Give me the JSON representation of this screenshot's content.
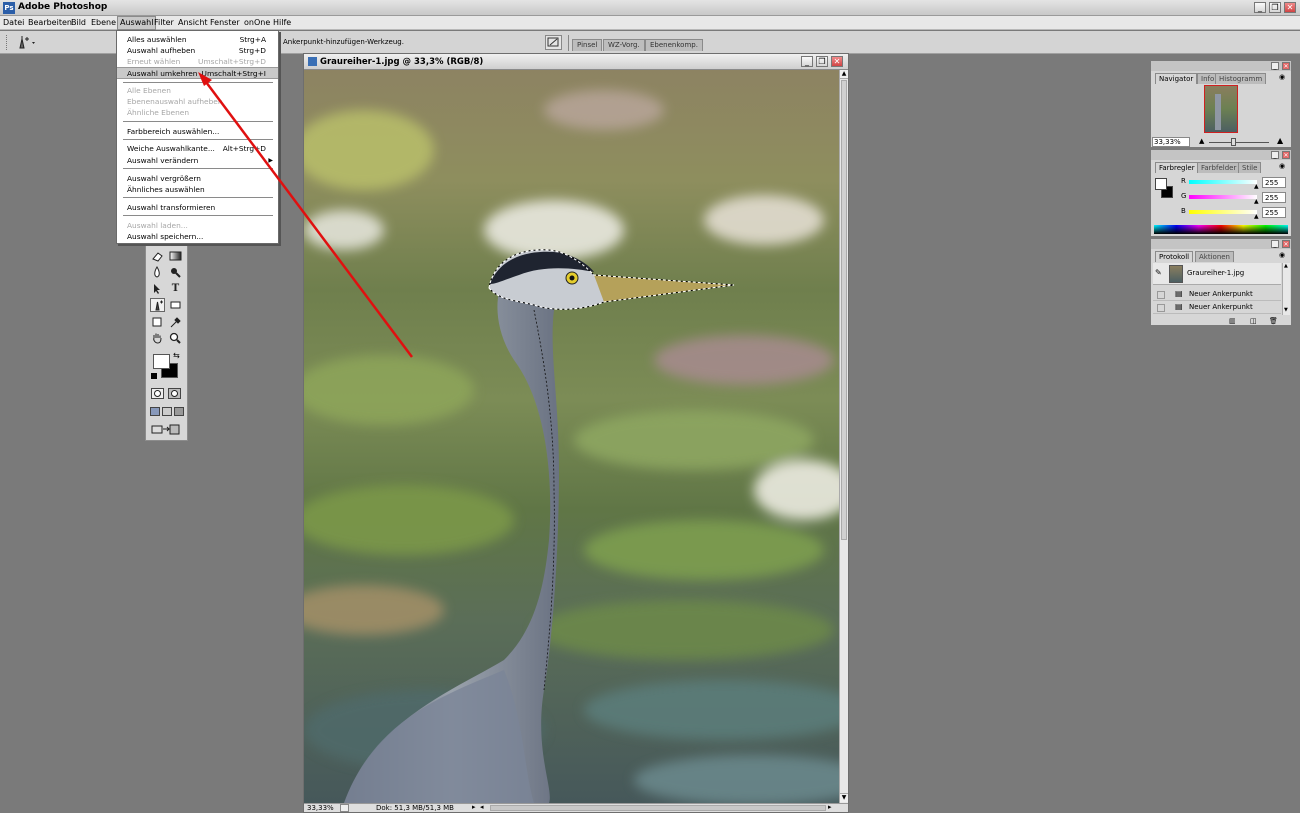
{
  "app": {
    "title": "Adobe Photoshop",
    "icon_name": "photoshop-icon",
    "window_buttons": [
      "_",
      "❐",
      "✕"
    ]
  },
  "menubar": [
    {
      "label": "Datei"
    },
    {
      "label": "Bearbeiten"
    },
    {
      "label": "Bild"
    },
    {
      "label": "Ebene"
    },
    {
      "label": "Auswahl",
      "active": true
    },
    {
      "label": "Filter"
    },
    {
      "label": "Ansicht"
    },
    {
      "label": "Fenster"
    },
    {
      "label": "onOne"
    },
    {
      "label": "Hilfe"
    }
  ],
  "options_bar": {
    "tool_icon": "add-anchor-point-pen-icon",
    "hint": "Ankerpunkt-hinzufügen-Werkzeug.",
    "palette_well_tabs": [
      "Pinsel",
      "WZ-Vorg.",
      "Ebenenkomp."
    ]
  },
  "auswahl_menu": {
    "items": [
      {
        "label": "Alles auswählen",
        "shortcut": "Strg+A",
        "enabled": true
      },
      {
        "label": "Auswahl aufheben",
        "shortcut": "Strg+D",
        "enabled": true
      },
      {
        "label": "Erneut wählen",
        "shortcut": "Umschalt+Strg+D",
        "enabled": false
      },
      {
        "label": "Auswahl umkehren",
        "shortcut": "Umschalt+Strg+I",
        "enabled": true,
        "highlighted": true
      },
      {
        "label": "Alle Ebenen",
        "shortcut": "",
        "enabled": false
      },
      {
        "label": "Ebenenauswahl aufheben",
        "shortcut": "",
        "enabled": false
      },
      {
        "label": "Ähnliche Ebenen",
        "shortcut": "",
        "enabled": false
      },
      {
        "label": "Farbbereich auswählen...",
        "shortcut": "",
        "enabled": true
      },
      {
        "label": "Weiche Auswahlkante...",
        "shortcut": "Alt+Strg+D",
        "enabled": true
      },
      {
        "label": "Auswahl verändern",
        "shortcut": "",
        "enabled": true,
        "submenu": true
      },
      {
        "label": "Auswahl vergrößern",
        "shortcut": "",
        "enabled": true
      },
      {
        "label": "Ähnliches auswählen",
        "shortcut": "",
        "enabled": true
      },
      {
        "label": "Auswahl transformieren",
        "shortcut": "",
        "enabled": true
      },
      {
        "label": "Auswahl laden...",
        "shortcut": "",
        "enabled": false
      },
      {
        "label": "Auswahl speichern...",
        "shortcut": "",
        "enabled": true
      }
    ]
  },
  "toolbox": {
    "tools": [
      "eraser-icon",
      "gradient-icon",
      "blur-icon",
      "dodge-icon",
      "path-selection-icon",
      "type-icon",
      "pen-icon",
      "shape-icon",
      "notes-icon",
      "eyedropper-icon",
      "hand-icon",
      "zoom-icon"
    ],
    "type_glyph": "T"
  },
  "document": {
    "title": "Graureiher-1.jpg @ 33,3% (RGB/8)",
    "zoom": "33,33%",
    "doc_size": "Dok: 51,3 MB/51,3 MB"
  },
  "navigator": {
    "tabs": [
      "Navigator",
      "Info",
      "Histogramm"
    ],
    "zoom": "33,33%"
  },
  "color": {
    "tabs": [
      "Farbregler",
      "Farbfelder",
      "Stile"
    ],
    "channels": [
      {
        "name": "R",
        "value": "255",
        "color": "#00c8c8"
      },
      {
        "name": "G",
        "value": "255",
        "color": "#e000e0"
      },
      {
        "name": "B",
        "value": "255",
        "color": "#e0e000"
      }
    ]
  },
  "history": {
    "tabs": [
      "Protokoll",
      "Aktionen"
    ],
    "snapshot": "Graureiher-1.jpg",
    "states": [
      "Neuer Ankerpunkt",
      "Neuer Ankerpunkt"
    ]
  },
  "colors": {
    "annotation_arrow": "#e01010",
    "menu_highlight": "#c9c9c9",
    "workspace": "#7a7a7a"
  }
}
